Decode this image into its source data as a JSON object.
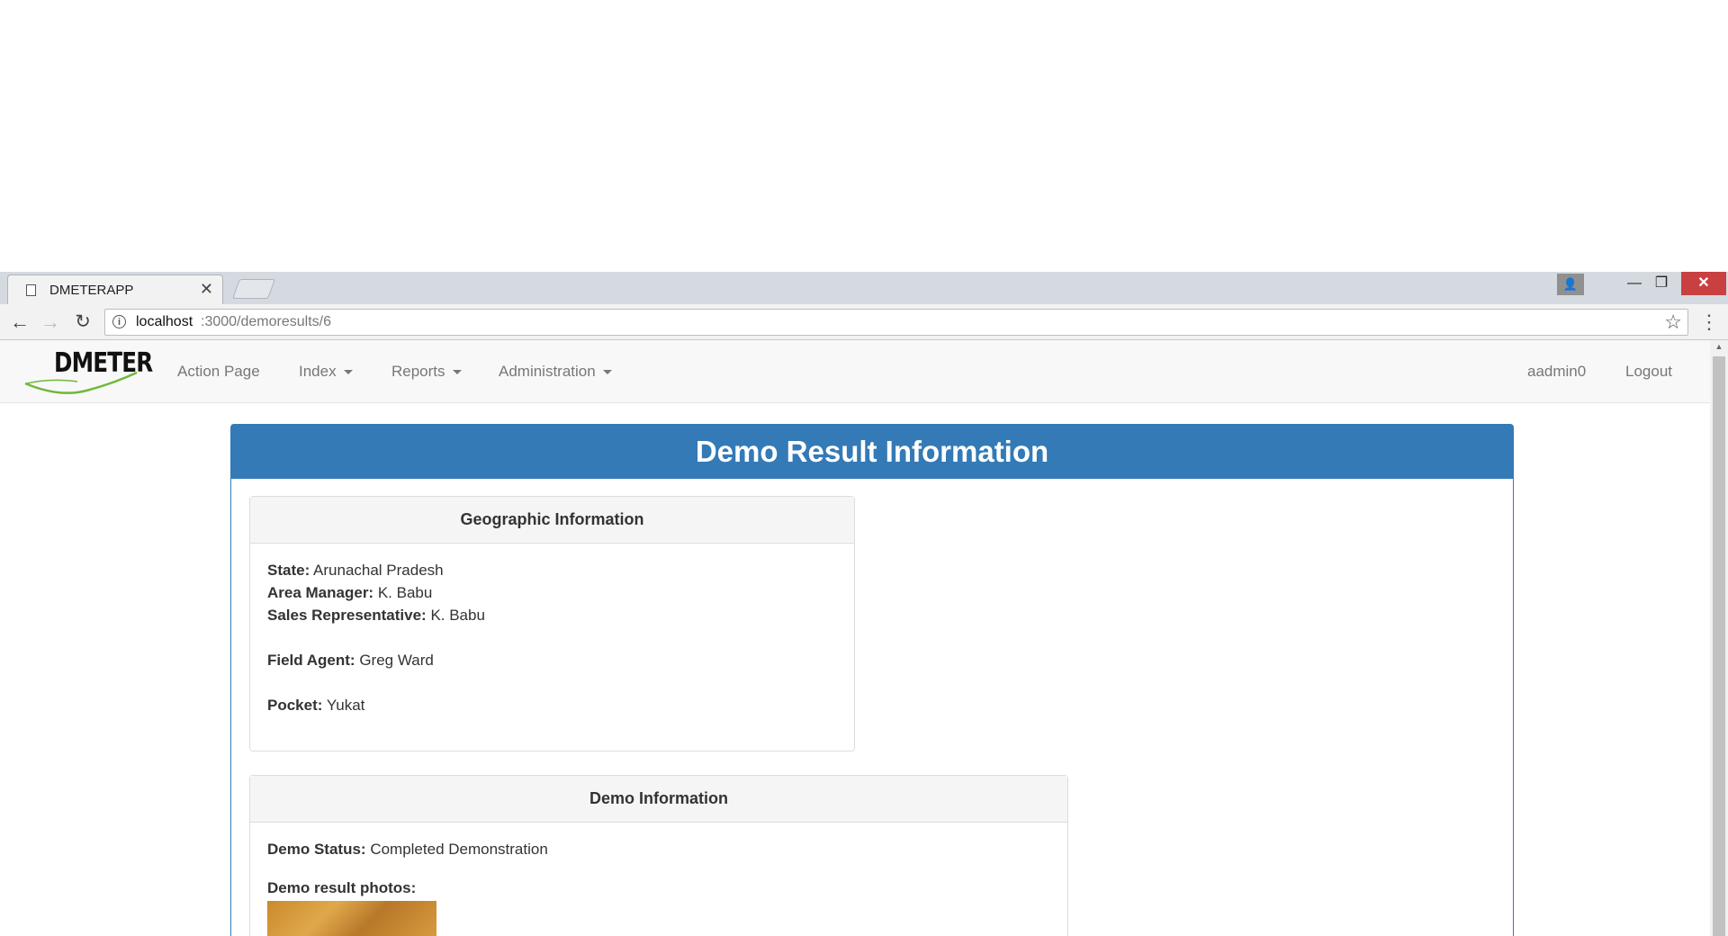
{
  "browser": {
    "tab_title": "DMETERAPP",
    "url_host": "localhost",
    "url_path": ":3000/demoresults/6"
  },
  "navbar": {
    "brand": "DMETER",
    "links": [
      {
        "label": "Action Page",
        "dropdown": false
      },
      {
        "label": "Index",
        "dropdown": true
      },
      {
        "label": "Reports",
        "dropdown": true
      },
      {
        "label": "Administration",
        "dropdown": true
      }
    ],
    "user": "aadmin0",
    "logout": "Logout"
  },
  "page": {
    "heading": "Demo Result Information",
    "geo": {
      "title": "Geographic Information",
      "state_label": "State:",
      "state": "Arunachal Pradesh",
      "area_manager_label": "Area Manager:",
      "area_manager": "K. Babu",
      "sales_rep_label": "Sales Representative:",
      "sales_rep": "K. Babu",
      "field_agent_label": "Field Agent:",
      "field_agent": "Greg Ward",
      "pocket_label": "Pocket:",
      "pocket": "Yukat"
    },
    "demo": {
      "title": "Demo Information",
      "status_label": "Demo Status:",
      "status": "Completed Demonstration",
      "photos_label": "Demo result photos:"
    }
  },
  "colors": {
    "primary": "#337ab7",
    "navbar_bg": "#f8f8f8",
    "panel_heading_bg": "#f5f5f5"
  }
}
